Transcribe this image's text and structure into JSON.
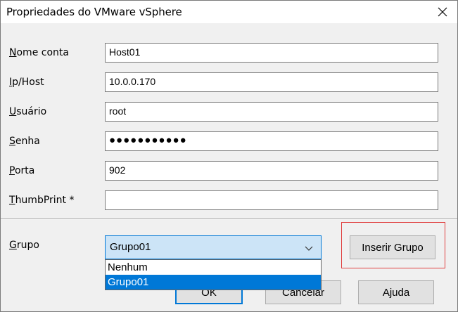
{
  "window": {
    "title": "Propriedades do VMware vSphere",
    "close_symbol": "close-icon"
  },
  "form": {
    "nome_conta": {
      "label_key": "N",
      "label_rest": "ome conta",
      "value": "Host01"
    },
    "ip_host": {
      "label_key": "I",
      "label_rest": "p/Host",
      "value": "10.0.0.170"
    },
    "usuario": {
      "label_key": "U",
      "label_rest": "suário",
      "value": "root"
    },
    "senha": {
      "label_key": "S",
      "label_rest": "enha",
      "value": "●●●●●●●●●●●"
    },
    "porta": {
      "label_key": "P",
      "label_rest": "orta",
      "value": "902"
    },
    "thumbprint": {
      "label_key": "T",
      "label_rest": "humbPrint *",
      "value": ""
    }
  },
  "grupo": {
    "label_key": "G",
    "label_rest": "rupo",
    "selected": "Grupo01",
    "options": [
      "Nenhum",
      "Grupo01"
    ]
  },
  "buttons": {
    "inserir_grupo": "Inserir Grupo",
    "ok": "OK",
    "cancelar": "Cancelar",
    "ajuda": "Ajuda"
  },
  "colors": {
    "accent": "#0078d7",
    "highlight_box": "#e04040"
  }
}
